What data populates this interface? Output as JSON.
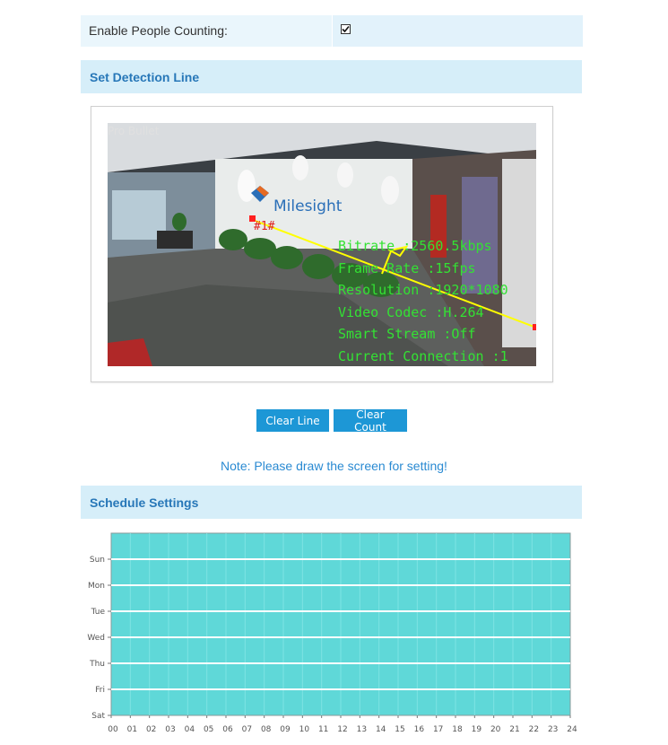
{
  "enable": {
    "label": "Enable People Counting:",
    "checked": true
  },
  "detection": {
    "title": "Set Detection Line"
  },
  "video": {
    "camera_name": "Pro Bullet",
    "logo_text": "Milesight",
    "line_label": "#1#",
    "osd": [
      "Bitrate :2560.5kbps",
      "Frame Rate :15fps",
      "Resolution :1920*1080",
      "Video Codec :H.264",
      "Smart Stream :Off",
      "Current Connection :1"
    ]
  },
  "buttons": {
    "clear_line": "Clear Line",
    "clear_count": "Clear Count"
  },
  "note": "Note: Please draw the screen for setting!",
  "schedule": {
    "title": "Schedule Settings",
    "days": [
      "Sun",
      "Mon",
      "Tue",
      "Wed",
      "Thu",
      "Fri",
      "Sat"
    ],
    "hours": [
      "00",
      "01",
      "02",
      "03",
      "04",
      "05",
      "06",
      "07",
      "08",
      "09",
      "10",
      "11",
      "12",
      "13",
      "14",
      "15",
      "16",
      "17",
      "18",
      "19",
      "20",
      "21",
      "22",
      "23",
      "24"
    ],
    "fill_color": "#5fd8d8"
  }
}
